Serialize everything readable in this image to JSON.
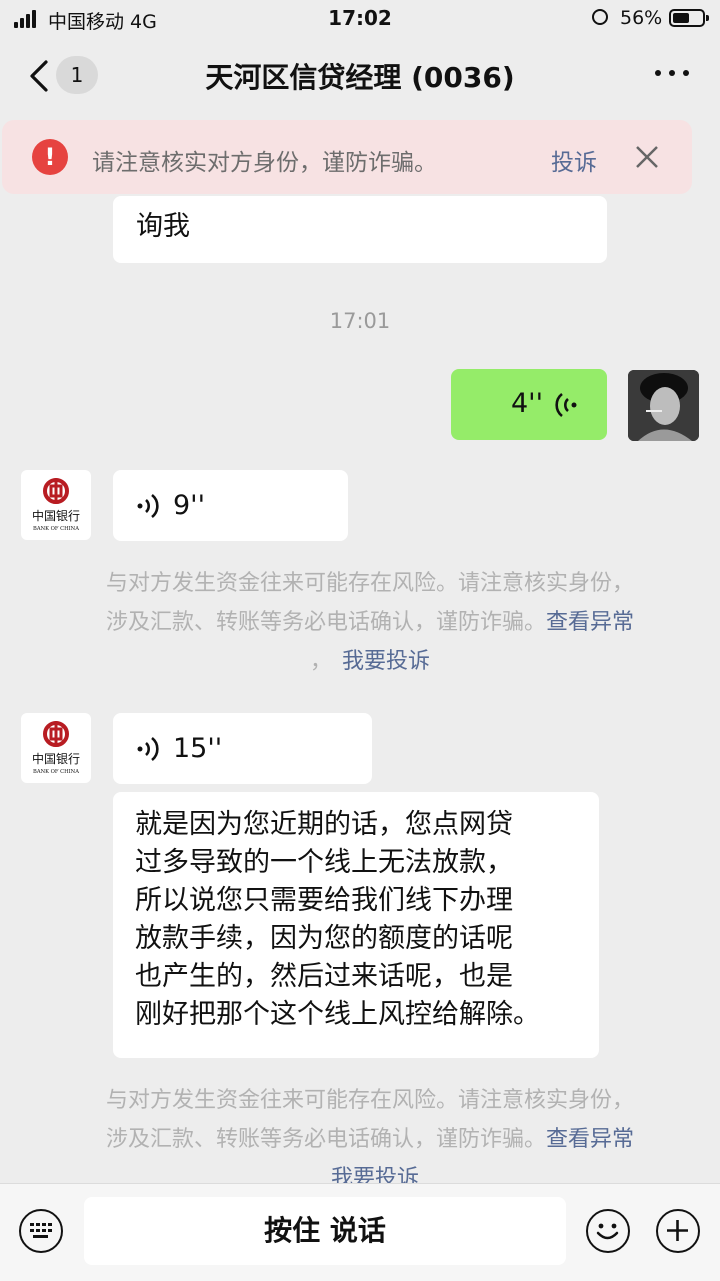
{
  "status_bar": {
    "carrier": "中国移动  4G",
    "time": "17:02",
    "battery": "56%"
  },
  "nav": {
    "unread_badge": "1",
    "title": "天河区信贷经理 (0036)"
  },
  "banner": {
    "text": "请注意核实对方身份，谨防诈骗。",
    "complain": "投诉"
  },
  "messages": {
    "partial_text": "询我",
    "timestamp": "17:01",
    "my_voice": "4''",
    "voice1": "9''",
    "sys1_line1": "与对方发生资金往来可能存在风险。请注意核实身份，",
    "sys1_line2": "涉及汇款、转账等务必电话确认，谨防诈骗。",
    "sys_link_view": "查看异常",
    "sys1_line3_prefix": "，",
    "sys_link_report": "我要投诉",
    "voice2": "15''",
    "text_lines": [
      "就是因为您近期的话，您点网贷",
      "过多导致的一个线上无法放款，",
      "所以说您只需要给我们线下办理",
      "放款手续，因为您的额度的话呢",
      "也产生的，然后过来话呢，也是",
      "刚好把那个这个线上风控给解除。"
    ],
    "sys2_line1": "与对方发生资金往来可能存在风险。请注意核实身份，",
    "sys2_line2": "涉及汇款、转账等务必电话确认，谨防诈骗。",
    "sys2_partial": "我要投诉"
  },
  "bank_logo": {
    "cn": "中国银行",
    "en": "BANK OF CHINA",
    "color": "#b81c22"
  },
  "input_bar": {
    "hold_to_talk": "按住 说话"
  },
  "colors": {
    "accent_link": "#576b95",
    "my_bubble": "#95ec69",
    "warning": "#e64340"
  }
}
